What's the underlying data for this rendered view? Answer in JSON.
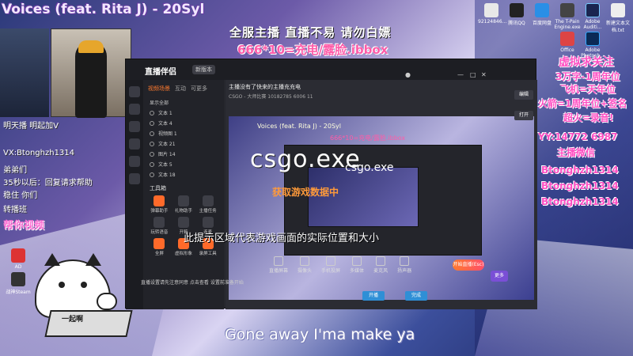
{
  "stream": {
    "title": "Voices (feat. Rita J) - 20Syl",
    "banner_line1": "全服主播 直播不易 请勿白嫖",
    "banner_line2": "666*10=充电/露脸.ibbox",
    "lyric": "Gone away I'ma make ya"
  },
  "left_overlay": {
    "line1": "明天播 明起加V",
    "line2": "VX:Btonghzh1314",
    "line3": "弟弟们",
    "line4": "35秒以后：回复请求帮助",
    "line5": "稳住 你们",
    "line6": "转播班",
    "line7": "帮你视频"
  },
  "right_overlay": {
    "line1": "虚拟求关注",
    "line2": "3万字-1周年位",
    "line3": "飞机=天年位",
    "line4": "火箭=1周年位+签名",
    "line5": "超火=录音!",
    "line6": "YY:14772 6987",
    "line7": "主播微信",
    "line8": "Btonghzh1314",
    "line9": "Btonghzh1314",
    "line10": "Btonghzh1314"
  },
  "app": {
    "name": "直播伴侣",
    "version": "新版本",
    "panel_tabs": [
      "视频场景",
      "互动",
      "可更多"
    ],
    "sources_header": "显示全部",
    "sources": [
      "文本 1",
      "文本 4",
      "视频图 1",
      "文本 21",
      "图片 14",
      "文本 5",
      "文本 18"
    ],
    "tools_title": "工具箱",
    "tools": [
      "弹幕助手",
      "礼物助手",
      "主播任务",
      "玩转语音",
      "开箱",
      "连麦",
      "全屏",
      "虚拟形象",
      "录屏工具"
    ],
    "room_title": "主播没有了快来的主播充充电",
    "room_tag": "CSGO - 大师比赛",
    "room_id": "10182785",
    "room_fans": "6006",
    "room_watch": "11",
    "preview_caption": "Voices (feat. Rita J) - 20Syl",
    "preview_banner": "666*10=充电/露脸.ibbox",
    "csgo_label": "csgo.exe",
    "csgo_label_small": "csgo.exe",
    "loading_text": "获取游戏数据中",
    "hint_text": "此提示区域代表游戏画面的实际位置和大小",
    "action_buttons": [
      "直播屏幕",
      "摄像头",
      "手机投屏",
      "多媒体",
      "麦克风",
      "扬声器"
    ],
    "start_button": "开始直播(Esc)",
    "notice_text": "直播设置请先注意同意 点击查看 设置前准备开始",
    "purple_label": "更多",
    "blue_button_1": "开播",
    "blue_button_2": "完成",
    "side_button_1": "编辑",
    "side_button_2": "打开"
  },
  "desktop_icons": [
    "92124846...",
    "腾讯QQ",
    "百度网盘",
    "The T-Pain Engine.exe",
    "Adobe Auditi...",
    "新建文本文档.txt",
    "Office",
    "Adobe Photosh...",
    "AD",
    "战神Steam"
  ],
  "sticker": {
    "keyboard_label": "一起啊"
  }
}
